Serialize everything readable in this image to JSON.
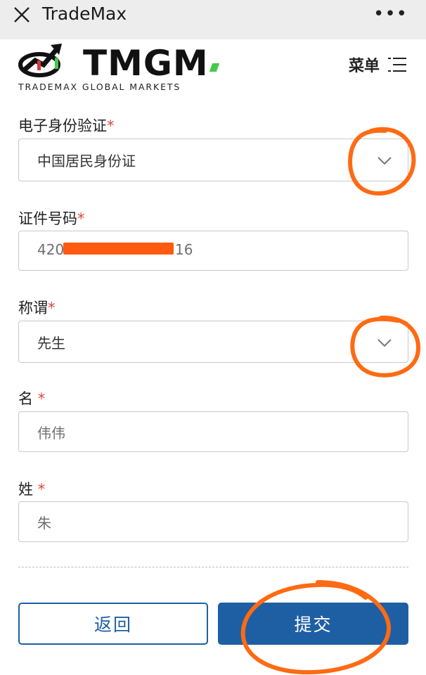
{
  "topbar": {
    "title": "TradeMax",
    "more": "•••"
  },
  "brand": {
    "logo_text": "TMGM",
    "subtitle": "TRADEMAX GLOBAL MARKETS"
  },
  "menu": {
    "label": "菜单"
  },
  "form": {
    "id_type": {
      "label": "电子身份验证",
      "required": "*",
      "value": "中国居民身份证"
    },
    "id_number": {
      "label": "证件号码",
      "required": "*",
      "value_prefix": "420",
      "value_suffix": "16"
    },
    "title": {
      "label": "称谓",
      "required": "*",
      "value": "先生"
    },
    "first_name": {
      "label": "名",
      "required": "*",
      "value": "伟伟"
    },
    "last_name": {
      "label": "姓",
      "required": "*",
      "value": "朱"
    }
  },
  "buttons": {
    "back": "返回",
    "submit": "提交"
  },
  "colors": {
    "accent": "#1e5fa3",
    "required": "#e0463f",
    "annotation": "#ff6a13",
    "logo_green": "#44c94a"
  }
}
